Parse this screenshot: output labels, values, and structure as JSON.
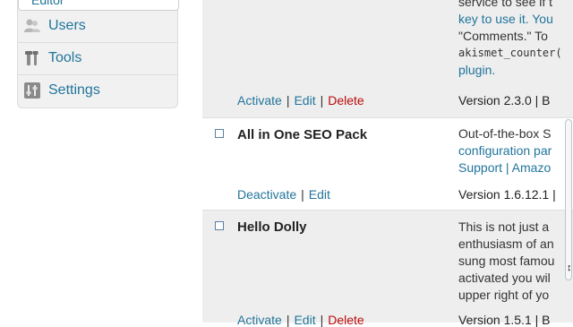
{
  "sidebar": {
    "editor_label": "Editor",
    "items": [
      {
        "label": "Users",
        "icon": "users-icon"
      },
      {
        "label": "Tools",
        "icon": "tools-icon"
      },
      {
        "label": "Settings",
        "icon": "settings-icon"
      }
    ]
  },
  "plugins": {
    "akismet": {
      "description_lines": [
        "service to see if t",
        "key to use it. You",
        "\"Comments.\" To",
        "akismet_counter(",
        "plugin."
      ],
      "actions": {
        "activate": "Activate",
        "edit": "Edit",
        "delete": "Delete"
      },
      "version": "Version 2.3.0 | B"
    },
    "all_in_one_seo": {
      "name": "All in One SEO Pack",
      "description_lines": [
        "Out-of-the-box S",
        "configuration par",
        "Support | Amazo"
      ],
      "actions": {
        "deactivate": "Deactivate",
        "edit": "Edit"
      },
      "version": "Version 1.6.12.1 |"
    },
    "hello_dolly": {
      "name": "Hello Dolly",
      "description_lines": [
        "This is not just a",
        "enthusiasm of an",
        "sung most famou",
        "activated you wil",
        "upper right of yo"
      ],
      "actions": {
        "activate": "Activate",
        "edit": "Edit",
        "delete": "Delete"
      },
      "version": "Version 1.5.1 | B"
    }
  },
  "colors": {
    "link": "#21759b",
    "delete": "#bc0b0b",
    "inactive_row": "#eeeeee"
  }
}
